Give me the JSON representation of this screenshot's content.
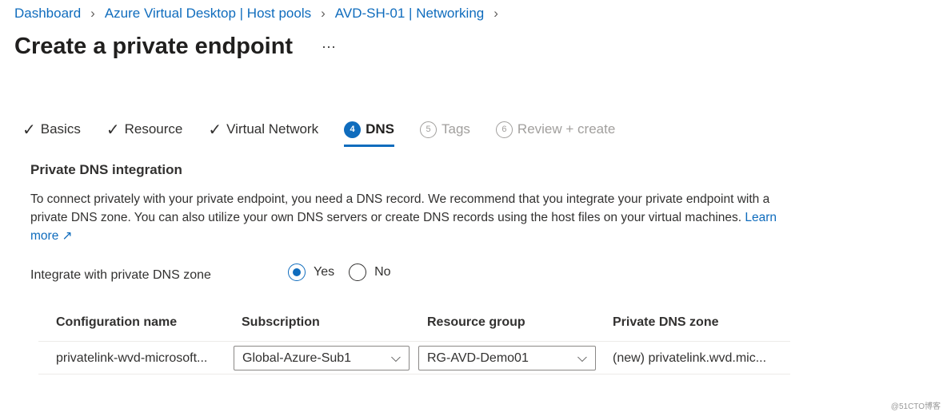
{
  "breadcrumb": [
    "Dashboard",
    "Azure Virtual Desktop | Host pools",
    "AVD-SH-01 | Networking"
  ],
  "title": "Create a private endpoint",
  "more": "···",
  "tabs": [
    {
      "label": "Basics",
      "state": "done"
    },
    {
      "label": "Resource",
      "state": "done"
    },
    {
      "label": "Virtual Network",
      "state": "done"
    },
    {
      "num": "4",
      "label": "DNS",
      "state": "active"
    },
    {
      "num": "5",
      "label": "Tags",
      "state": "disabled"
    },
    {
      "num": "6",
      "label": "Review + create",
      "state": "disabled"
    }
  ],
  "section": "Private DNS integration",
  "description": "To connect privately with your private endpoint, you need a DNS record. We recommend that you integrate your private endpoint with a private DNS zone. You can also utilize your own DNS servers or create DNS records using the host files on your virtual machines.",
  "learn_more": "Learn more",
  "integrate_label": "Integrate with private DNS zone",
  "radio_yes": "Yes",
  "radio_no": "No",
  "selected": "Yes",
  "table": {
    "headers": [
      "Configuration name",
      "Subscription",
      "Resource group",
      "Private DNS zone"
    ],
    "row": {
      "config": "privatelink-wvd-microsoft...",
      "subscription": "Global-Azure-Sub1",
      "resource_group": "RG-AVD-Demo01",
      "zone": "(new) privatelink.wvd.mic..."
    }
  },
  "watermark": "@51CTO博客",
  "colors": {
    "accent": "#0f6cbd"
  }
}
